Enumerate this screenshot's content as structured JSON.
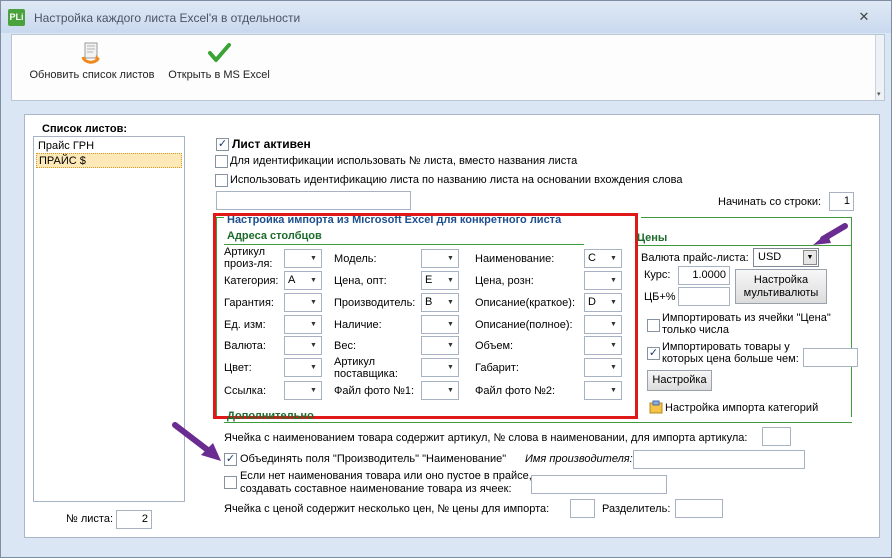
{
  "window": {
    "app_icon": "PLi",
    "title": "Настройка каждого листа Excel'я в отдельности",
    "close_label": "✕"
  },
  "toolbar": {
    "refresh_label": "Обновить список листов",
    "refresh_icon": "refresh-sheets-icon",
    "open_label": "Открыть в MS Excel",
    "open_icon": "checkmark-icon",
    "scroll_label": "▾"
  },
  "sheets": {
    "header": "Список листов:",
    "items": [
      "Прайс ГРН",
      "ПРАЙС $"
    ],
    "selected_index": 1,
    "sheet_no_label": "№ листа:",
    "sheet_no_value": "2"
  },
  "options": {
    "active_label": "Лист активен",
    "active_checked": true,
    "use_number_label": "Для идентификации использовать № листа, вместо названия листа",
    "use_number_checked": false,
    "by_name_label": "Использовать идентификацию листа по названию листа на основании вхождения слова",
    "by_name_checked": false,
    "by_name_value": "",
    "start_row_label": "Начинать со строки:",
    "start_row_value": "1"
  },
  "import": {
    "header": "Настройка импорта из Microsoft Excel для конкретного листа",
    "columns_header": "Адреса столбцов",
    "col1": [
      {
        "label": "Артикул произ-ля:",
        "value": ""
      },
      {
        "label": "Категория:",
        "value": "A"
      },
      {
        "label": "Гарантия:",
        "value": ""
      },
      {
        "label": "Ед. изм:",
        "value": ""
      },
      {
        "label": "Валюта:",
        "value": ""
      },
      {
        "label": "Цвет:",
        "value": ""
      },
      {
        "label": "Ссылка:",
        "value": ""
      }
    ],
    "col2": [
      {
        "label": "Модель:",
        "value": ""
      },
      {
        "label": "Цена, опт:",
        "value": "E"
      },
      {
        "label": "Производитель:",
        "value": "B"
      },
      {
        "label": "Наличие:",
        "value": ""
      },
      {
        "label": "Вес:",
        "value": ""
      },
      {
        "label": "Артикул поставщика:",
        "value": ""
      },
      {
        "label": "Файл фото №1:",
        "value": ""
      }
    ],
    "col3": [
      {
        "label": "Наименование:",
        "value": "C"
      },
      {
        "label": "Цена, розн:",
        "value": ""
      },
      {
        "label": "Описание(краткое):",
        "value": "D"
      },
      {
        "label": "Описание(полное):",
        "value": ""
      },
      {
        "label": "Объем:",
        "value": ""
      },
      {
        "label": "Габарит:",
        "value": ""
      },
      {
        "label": "Файл фото №2:",
        "value": ""
      }
    ],
    "additional_header": "Дополнительно"
  },
  "prices": {
    "header": "Цены",
    "currency_label": "Валюта прайс-листа:",
    "currency_value": "USD",
    "rate_label": "Курс:",
    "rate_value": "1.0000",
    "cb_label": "ЦБ+%",
    "cb_value": "",
    "multi_button": "Настройка мультивалюты",
    "import_from_price_label": "Импортировать из ячейки \"Цена\" только числа",
    "import_from_price_checked": false,
    "import_above_label": "Импортировать товары у которых цена больше чем:",
    "import_above_checked": true,
    "import_above_value": "",
    "settings_button": "Настройка",
    "categories_button": "Настройка импорта категорий"
  },
  "additional": {
    "article_label": "Ячейка с наименованием товара содержит артикул, № слова в наименовании, для импорта артикула:",
    "article_value": "",
    "merge_label": "Объединять поля \"Производитель\" \"Наименование\"",
    "merge_checked": true,
    "manufacturer_name_label": "Имя производителя:",
    "manufacturer_name_value": "",
    "compose_label_1": "Если нет наименования товара или оно пустое в прайсе,",
    "compose_label_2": "создавать составное наименование товара из ячеек:",
    "compose_checked": false,
    "compose_value": "",
    "multi_price_label": "Ячейка с ценой содержит несколько цен, № цены для импорта:",
    "multi_price_value": "",
    "separator_label": "Разделитель:",
    "separator_value": ""
  },
  "colors": {
    "red_box": "#e01818",
    "arrow": "#6a2c91",
    "section_line": "#3f9a3c"
  }
}
